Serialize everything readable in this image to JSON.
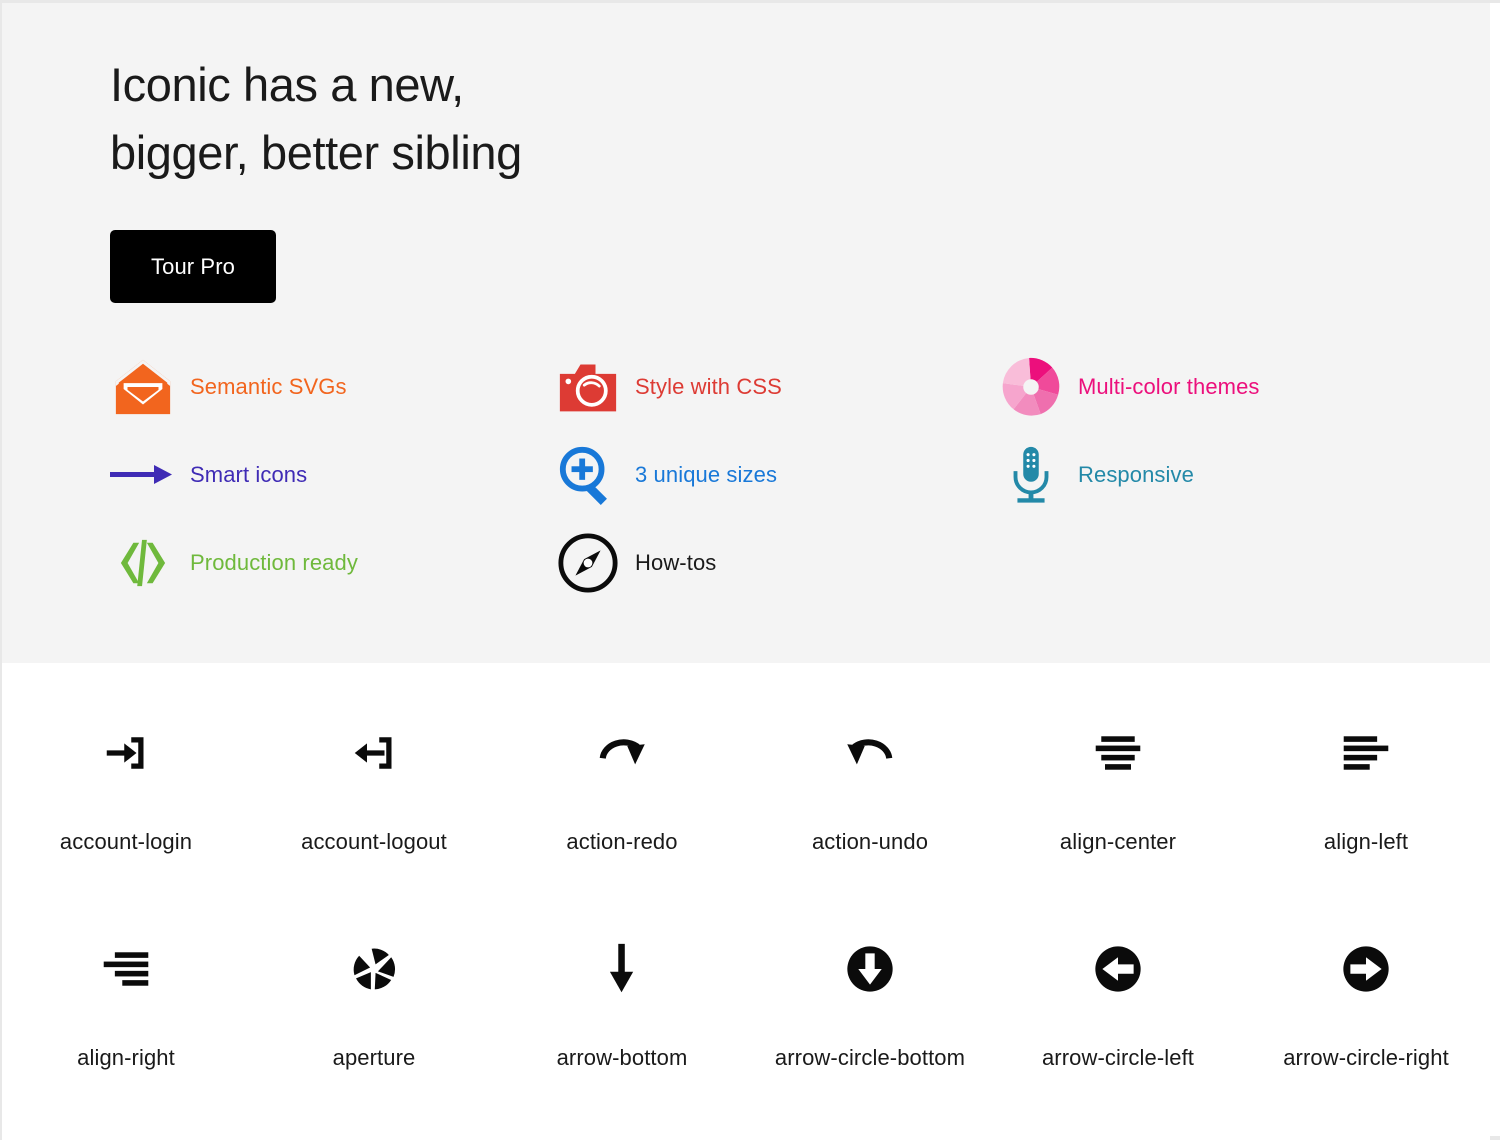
{
  "hero": {
    "headline": "Iconic has a new,\nbigger, better sibling",
    "button_label": "Tour Pro",
    "background_color": "#f4f4f4"
  },
  "features": [
    {
      "label": "Semantic SVGs",
      "icon": "envelope-icon",
      "color": "#f2651e"
    },
    {
      "label": "Style with CSS",
      "icon": "camera-icon",
      "color": "#dd3b34"
    },
    {
      "label": "Multi-color themes",
      "icon": "aperture-icon",
      "color": "#ec0f7c"
    },
    {
      "label": "Smart icons",
      "icon": "arrow-right-icon",
      "color": "#3f2bb5"
    },
    {
      "label": "3 unique sizes",
      "icon": "zoom-in-icon",
      "color": "#1878d8"
    },
    {
      "label": "Responsive",
      "icon": "microphone-icon",
      "color": "#2389a8"
    },
    {
      "label": "Production ready",
      "icon": "code-icon",
      "color": "#6fb93c"
    },
    {
      "label": "How-tos",
      "icon": "compass-icon",
      "color": "#1a1a1a"
    }
  ],
  "icon_grid": [
    {
      "name": "account-login",
      "icon": "account-login-icon"
    },
    {
      "name": "account-logout",
      "icon": "account-logout-icon"
    },
    {
      "name": "action-redo",
      "icon": "action-redo-icon"
    },
    {
      "name": "action-undo",
      "icon": "action-undo-icon"
    },
    {
      "name": "align-center",
      "icon": "align-center-icon"
    },
    {
      "name": "align-left",
      "icon": "align-left-icon"
    },
    {
      "name": "align-right",
      "icon": "align-right-icon"
    },
    {
      "name": "aperture",
      "icon": "aperture-black-icon"
    },
    {
      "name": "arrow-bottom",
      "icon": "arrow-bottom-icon"
    },
    {
      "name": "arrow-circle-bottom",
      "icon": "arrow-circle-bottom-icon"
    },
    {
      "name": "arrow-circle-left",
      "icon": "arrow-circle-left-icon"
    },
    {
      "name": "arrow-circle-right",
      "icon": "arrow-circle-right-icon"
    }
  ]
}
